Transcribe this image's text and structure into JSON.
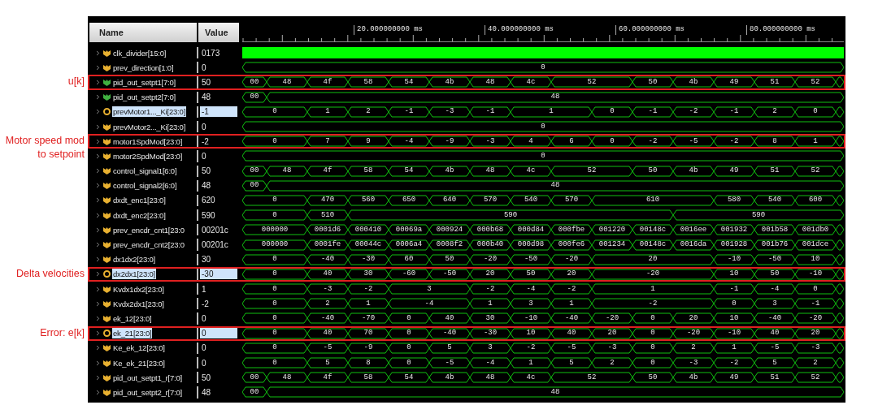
{
  "columns": {
    "name": "Name",
    "value": "Value"
  },
  "timeline": {
    "ticks": [
      "20.000000000 ms",
      "40.000000000 ms",
      "60.000000000 ms",
      "80.000000000 ms"
    ]
  },
  "signals": [
    {
      "name": "clk_divider[15:0]",
      "value": "0173",
      "color": "#e8b030",
      "selected": false,
      "highlighted": false,
      "kind": "solid"
    },
    {
      "name": "prev_direction[1:0]",
      "value": "0",
      "color": "#e8b030",
      "selected": false,
      "highlighted": false,
      "kind": "bus",
      "continues": false,
      "segments": [
        {
          "value": "0",
          "kind": "fifteen"
        }
      ]
    },
    {
      "name": "pid_out_setpt1[7:0]",
      "value": "50",
      "color": "#40b040",
      "selected": false,
      "highlighted": true,
      "annotation": "u[k]",
      "kind": "bus",
      "continues": true,
      "segments": [
        {
          "value": "00",
          "kind": "one"
        },
        {
          "value": "48",
          "kind": "one"
        },
        {
          "value": "4f",
          "kind": "one"
        },
        {
          "value": "58",
          "kind": "one"
        },
        {
          "value": "54",
          "kind": "one"
        },
        {
          "value": "4b",
          "kind": "one"
        },
        {
          "value": "48",
          "kind": "one"
        },
        {
          "value": "4c",
          "kind": "one"
        },
        {
          "value": "52",
          "kind": "two"
        },
        {
          "value": "50",
          "kind": "one"
        },
        {
          "value": "4b",
          "kind": "one"
        },
        {
          "value": "49",
          "kind": "one"
        },
        {
          "value": "51",
          "kind": "one"
        },
        {
          "value": "52",
          "kind": "one"
        }
      ]
    },
    {
      "name": "pid_out_setpt2[7:0]",
      "value": "48",
      "color": "#40b040",
      "selected": false,
      "highlighted": false,
      "kind": "bus",
      "continues": false,
      "segments": [
        {
          "value": "00",
          "kind": "one"
        },
        {
          "value": "48",
          "kind": "fourteen"
        }
      ]
    },
    {
      "name": "prevMotor1..._Ki[23:0]",
      "value": "-1",
      "color": "#e8b030",
      "selected": true,
      "highlighted": false,
      "kind": "bus",
      "continues": true,
      "segments": [
        {
          "value": "0",
          "kind": "two"
        },
        {
          "value": "1",
          "kind": "one"
        },
        {
          "value": "2",
          "kind": "one"
        },
        {
          "value": "-1",
          "kind": "one"
        },
        {
          "value": "-3",
          "kind": "one"
        },
        {
          "value": "-1",
          "kind": "one"
        },
        {
          "value": "1",
          "kind": "two"
        },
        {
          "value": "0",
          "kind": "one"
        },
        {
          "value": "-1",
          "kind": "one"
        },
        {
          "value": "-2",
          "kind": "one"
        },
        {
          "value": "-1",
          "kind": "one"
        },
        {
          "value": "2",
          "kind": "one"
        },
        {
          "value": "0",
          "kind": "one"
        }
      ]
    },
    {
      "name": "prevMotor2..._Ki[23:0]",
      "value": "0",
      "color": "#e8b030",
      "selected": false,
      "highlighted": false,
      "kind": "bus",
      "continues": false,
      "segments": [
        {
          "value": "0",
          "kind": "fifteen"
        }
      ]
    },
    {
      "name": "motor1SpdMod[23:0]",
      "value": "-2",
      "color": "#e8b030",
      "selected": false,
      "highlighted": true,
      "annotation": "Motor speed mod to setpoint",
      "kind": "bus",
      "continues": true,
      "segments": [
        {
          "value": "0",
          "kind": "two"
        },
        {
          "value": "7",
          "kind": "one"
        },
        {
          "value": "9",
          "kind": "one"
        },
        {
          "value": "-4",
          "kind": "one"
        },
        {
          "value": "-9",
          "kind": "one"
        },
        {
          "value": "-3",
          "kind": "one"
        },
        {
          "value": "4",
          "kind": "one"
        },
        {
          "value": "6",
          "kind": "one"
        },
        {
          "value": "0",
          "kind": "one"
        },
        {
          "value": "-2",
          "kind": "one"
        },
        {
          "value": "-5",
          "kind": "one"
        },
        {
          "value": "-2",
          "kind": "one"
        },
        {
          "value": "8",
          "kind": "one"
        },
        {
          "value": "1",
          "kind": "one"
        }
      ]
    },
    {
      "name": "motor2SpdMod[23:0]",
      "value": "0",
      "color": "#e8b030",
      "selected": false,
      "highlighted": false,
      "kind": "bus",
      "continues": false,
      "segments": [
        {
          "value": "0",
          "kind": "fifteen"
        }
      ]
    },
    {
      "name": "control_signal1[6:0]",
      "value": "50",
      "color": "#e8b030",
      "selected": false,
      "highlighted": false,
      "kind": "bus",
      "continues": true,
      "segments": [
        {
          "value": "00",
          "kind": "one"
        },
        {
          "value": "48",
          "kind": "one"
        },
        {
          "value": "4f",
          "kind": "one"
        },
        {
          "value": "58",
          "kind": "one"
        },
        {
          "value": "54",
          "kind": "one"
        },
        {
          "value": "4b",
          "kind": "one"
        },
        {
          "value": "48",
          "kind": "one"
        },
        {
          "value": "4c",
          "kind": "one"
        },
        {
          "value": "52",
          "kind": "two"
        },
        {
          "value": "50",
          "kind": "one"
        },
        {
          "value": "4b",
          "kind": "one"
        },
        {
          "value": "49",
          "kind": "one"
        },
        {
          "value": "51",
          "kind": "one"
        },
        {
          "value": "52",
          "kind": "one"
        }
      ]
    },
    {
      "name": "control_signal2[6:0]",
      "value": "48",
      "color": "#e8b030",
      "selected": false,
      "highlighted": false,
      "kind": "bus",
      "continues": false,
      "segments": [
        {
          "value": "00",
          "kind": "one"
        },
        {
          "value": "48",
          "kind": "fourteen"
        }
      ]
    },
    {
      "name": "dxdt_enc1[23:0]",
      "value": "620",
      "color": "#e8b030",
      "selected": false,
      "highlighted": false,
      "kind": "bus",
      "continues": true,
      "segments": [
        {
          "value": "0",
          "kind": "two"
        },
        {
          "value": "470",
          "kind": "one"
        },
        {
          "value": "560",
          "kind": "one"
        },
        {
          "value": "650",
          "kind": "one"
        },
        {
          "value": "640",
          "kind": "one"
        },
        {
          "value": "570",
          "kind": "one"
        },
        {
          "value": "540",
          "kind": "one"
        },
        {
          "value": "570",
          "kind": "one"
        },
        {
          "value": "610",
          "kind": "three"
        },
        {
          "value": "580",
          "kind": "one"
        },
        {
          "value": "540",
          "kind": "one"
        },
        {
          "value": "600",
          "kind": "one"
        }
      ]
    },
    {
      "name": "dxdt_enc2[23:0]",
      "value": "590",
      "color": "#e8b030",
      "selected": false,
      "highlighted": false,
      "kind": "bus",
      "continues": false,
      "segments": [
        {
          "value": "0",
          "kind": "two"
        },
        {
          "value": "510",
          "kind": "one"
        },
        {
          "value": "590",
          "kind": "eight"
        },
        {
          "value": "590",
          "kind": "four"
        }
      ]
    },
    {
      "name": "prev_encdr_cnt1[23:0",
      "value": "00201c",
      "color": "#e8b030",
      "selected": false,
      "highlighted": false,
      "kind": "bus",
      "continues": true,
      "segments": [
        {
          "value": "000000",
          "kind": "two"
        },
        {
          "value": "0001d6",
          "kind": "one"
        },
        {
          "value": "000410",
          "kind": "one"
        },
        {
          "value": "00069a",
          "kind": "one"
        },
        {
          "value": "000924",
          "kind": "one"
        },
        {
          "value": "000b68",
          "kind": "one"
        },
        {
          "value": "000d84",
          "kind": "one"
        },
        {
          "value": "000fbe",
          "kind": "one"
        },
        {
          "value": "001220",
          "kind": "one"
        },
        {
          "value": "00148c",
          "kind": "one"
        },
        {
          "value": "0016ee",
          "kind": "one"
        },
        {
          "value": "001932",
          "kind": "one"
        },
        {
          "value": "001b58",
          "kind": "one"
        },
        {
          "value": "001db0",
          "kind": "one"
        }
      ]
    },
    {
      "name": "prev_encdr_cnt2[23:0",
      "value": "00201c",
      "color": "#e8b030",
      "selected": false,
      "highlighted": false,
      "kind": "bus",
      "continues": true,
      "segments": [
        {
          "value": "000000",
          "kind": "two"
        },
        {
          "value": "0001fe",
          "kind": "one"
        },
        {
          "value": "00044c",
          "kind": "one"
        },
        {
          "value": "0006a4",
          "kind": "one"
        },
        {
          "value": "0008f2",
          "kind": "one"
        },
        {
          "value": "000b40",
          "kind": "one"
        },
        {
          "value": "000d98",
          "kind": "one"
        },
        {
          "value": "000fe6",
          "kind": "one"
        },
        {
          "value": "001234",
          "kind": "one"
        },
        {
          "value": "00148c",
          "kind": "one"
        },
        {
          "value": "0016da",
          "kind": "one"
        },
        {
          "value": "001928",
          "kind": "one"
        },
        {
          "value": "001b76",
          "kind": "one"
        },
        {
          "value": "001dce",
          "kind": "one"
        }
      ]
    },
    {
      "name": "dx1dx2[23:0]",
      "value": "30",
      "color": "#e8b030",
      "selected": false,
      "highlighted": false,
      "kind": "bus",
      "continues": true,
      "segments": [
        {
          "value": "0",
          "kind": "two"
        },
        {
          "value": "-40",
          "kind": "one"
        },
        {
          "value": "-30",
          "kind": "one"
        },
        {
          "value": "60",
          "kind": "one"
        },
        {
          "value": "50",
          "kind": "one"
        },
        {
          "value": "-20",
          "kind": "one"
        },
        {
          "value": "-50",
          "kind": "one"
        },
        {
          "value": "-20",
          "kind": "one"
        },
        {
          "value": "20",
          "kind": "three"
        },
        {
          "value": "-10",
          "kind": "one"
        },
        {
          "value": "-50",
          "kind": "one"
        },
        {
          "value": "10",
          "kind": "one"
        }
      ]
    },
    {
      "name": "dx2dx1[23:0]",
      "value": "-30",
      "color": "#e8b030",
      "selected": true,
      "highlighted": true,
      "annotation": "Delta velocities",
      "kind": "bus",
      "continues": true,
      "segments": [
        {
          "value": "0",
          "kind": "two"
        },
        {
          "value": "40",
          "kind": "one"
        },
        {
          "value": "30",
          "kind": "one"
        },
        {
          "value": "-60",
          "kind": "one"
        },
        {
          "value": "-50",
          "kind": "one"
        },
        {
          "value": "20",
          "kind": "one"
        },
        {
          "value": "50",
          "kind": "one"
        },
        {
          "value": "20",
          "kind": "one"
        },
        {
          "value": "-20",
          "kind": "three"
        },
        {
          "value": "10",
          "kind": "one"
        },
        {
          "value": "50",
          "kind": "one"
        },
        {
          "value": "-10",
          "kind": "one"
        }
      ]
    },
    {
      "name": "Kvdx1dx2[23:0]",
      "value": "1",
      "color": "#e8b030",
      "selected": false,
      "highlighted": false,
      "kind": "bus",
      "continues": true,
      "segments": [
        {
          "value": "0",
          "kind": "two"
        },
        {
          "value": "-3",
          "kind": "one"
        },
        {
          "value": "-2",
          "kind": "one"
        },
        {
          "value": "3",
          "kind": "two"
        },
        {
          "value": "-2",
          "kind": "one"
        },
        {
          "value": "-4",
          "kind": "one"
        },
        {
          "value": "-2",
          "kind": "one"
        },
        {
          "value": "1",
          "kind": "three"
        },
        {
          "value": "-1",
          "kind": "one"
        },
        {
          "value": "-4",
          "kind": "one"
        },
        {
          "value": "0",
          "kind": "one"
        }
      ]
    },
    {
      "name": "Kvdx2dx1[23:0]",
      "value": "-2",
      "color": "#e8b030",
      "selected": false,
      "highlighted": false,
      "kind": "bus",
      "continues": true,
      "segments": [
        {
          "value": "0",
          "kind": "two"
        },
        {
          "value": "2",
          "kind": "one"
        },
        {
          "value": "1",
          "kind": "one"
        },
        {
          "value": "-4",
          "kind": "two"
        },
        {
          "value": "1",
          "kind": "one"
        },
        {
          "value": "3",
          "kind": "one"
        },
        {
          "value": "1",
          "kind": "one"
        },
        {
          "value": "-2",
          "kind": "three"
        },
        {
          "value": "0",
          "kind": "one"
        },
        {
          "value": "3",
          "kind": "one"
        },
        {
          "value": "-1",
          "kind": "one"
        }
      ]
    },
    {
      "name": "ek_12[23:0]",
      "value": "0",
      "color": "#e8b030",
      "selected": false,
      "highlighted": false,
      "kind": "bus",
      "continues": true,
      "segments": [
        {
          "value": "0",
          "kind": "two"
        },
        {
          "value": "-40",
          "kind": "one"
        },
        {
          "value": "-70",
          "kind": "one"
        },
        {
          "value": "0",
          "kind": "one"
        },
        {
          "value": "40",
          "kind": "one"
        },
        {
          "value": "30",
          "kind": "one"
        },
        {
          "value": "-10",
          "kind": "one"
        },
        {
          "value": "-40",
          "kind": "one"
        },
        {
          "value": "-20",
          "kind": "one"
        },
        {
          "value": "0",
          "kind": "one"
        },
        {
          "value": "20",
          "kind": "one"
        },
        {
          "value": "10",
          "kind": "one"
        },
        {
          "value": "-40",
          "kind": "one"
        },
        {
          "value": "-20",
          "kind": "one"
        }
      ]
    },
    {
      "name": "ek_21[23:0]",
      "value": "0",
      "color": "#e8b030",
      "selected": true,
      "highlighted": true,
      "annotation": "Error: e[k]",
      "kind": "bus",
      "continues": true,
      "segments": [
        {
          "value": "0",
          "kind": "two"
        },
        {
          "value": "40",
          "kind": "one"
        },
        {
          "value": "70",
          "kind": "one"
        },
        {
          "value": "0",
          "kind": "one"
        },
        {
          "value": "-40",
          "kind": "one"
        },
        {
          "value": "-30",
          "kind": "one"
        },
        {
          "value": "10",
          "kind": "one"
        },
        {
          "value": "40",
          "kind": "one"
        },
        {
          "value": "20",
          "kind": "one"
        },
        {
          "value": "0",
          "kind": "one"
        },
        {
          "value": "-20",
          "kind": "one"
        },
        {
          "value": "-10",
          "kind": "one"
        },
        {
          "value": "40",
          "kind": "one"
        },
        {
          "value": "20",
          "kind": "one"
        }
      ]
    },
    {
      "name": "Ke_ek_12[23:0]",
      "value": "0",
      "color": "#e8b030",
      "selected": false,
      "highlighted": false,
      "kind": "bus",
      "continues": true,
      "segments": [
        {
          "value": "0",
          "kind": "two"
        },
        {
          "value": "-5",
          "kind": "one"
        },
        {
          "value": "-9",
          "kind": "one"
        },
        {
          "value": "0",
          "kind": "one"
        },
        {
          "value": "5",
          "kind": "one"
        },
        {
          "value": "3",
          "kind": "one"
        },
        {
          "value": "-2",
          "kind": "one"
        },
        {
          "value": "-5",
          "kind": "one"
        },
        {
          "value": "-3",
          "kind": "one"
        },
        {
          "value": "0",
          "kind": "one"
        },
        {
          "value": "2",
          "kind": "one"
        },
        {
          "value": "1",
          "kind": "one"
        },
        {
          "value": "-5",
          "kind": "one"
        },
        {
          "value": "-3",
          "kind": "one"
        }
      ]
    },
    {
      "name": "Ke_ek_21[23:0]",
      "value": "0",
      "color": "#e8b030",
      "selected": false,
      "highlighted": false,
      "kind": "bus",
      "continues": true,
      "segments": [
        {
          "value": "0",
          "kind": "two"
        },
        {
          "value": "5",
          "kind": "one"
        },
        {
          "value": "8",
          "kind": "one"
        },
        {
          "value": "0",
          "kind": "one"
        },
        {
          "value": "-5",
          "kind": "one"
        },
        {
          "value": "-4",
          "kind": "one"
        },
        {
          "value": "1",
          "kind": "one"
        },
        {
          "value": "5",
          "kind": "one"
        },
        {
          "value": "2",
          "kind": "one"
        },
        {
          "value": "0",
          "kind": "one"
        },
        {
          "value": "-3",
          "kind": "one"
        },
        {
          "value": "-2",
          "kind": "one"
        },
        {
          "value": "5",
          "kind": "one"
        },
        {
          "value": "2",
          "kind": "one"
        }
      ]
    },
    {
      "name": "pid_out_setpt1_r[7:0]",
      "value": "50",
      "color": "#e8b030",
      "selected": false,
      "highlighted": false,
      "kind": "bus",
      "continues": true,
      "segments": [
        {
          "value": "00",
          "kind": "one"
        },
        {
          "value": "48",
          "kind": "one"
        },
        {
          "value": "4f",
          "kind": "one"
        },
        {
          "value": "58",
          "kind": "one"
        },
        {
          "value": "54",
          "kind": "one"
        },
        {
          "value": "4b",
          "kind": "one"
        },
        {
          "value": "48",
          "kind": "one"
        },
        {
          "value": "4c",
          "kind": "one"
        },
        {
          "value": "52",
          "kind": "two"
        },
        {
          "value": "50",
          "kind": "one"
        },
        {
          "value": "4b",
          "kind": "one"
        },
        {
          "value": "49",
          "kind": "one"
        },
        {
          "value": "51",
          "kind": "one"
        },
        {
          "value": "52",
          "kind": "one"
        }
      ]
    },
    {
      "name": "pid_out_setpt2_r[7:0]",
      "value": "48",
      "color": "#e8b030",
      "selected": false,
      "highlighted": false,
      "kind": "bus",
      "continues": false,
      "segments": [
        {
          "value": "00",
          "kind": "one"
        },
        {
          "value": "48",
          "kind": "fourteen"
        }
      ]
    }
  ]
}
